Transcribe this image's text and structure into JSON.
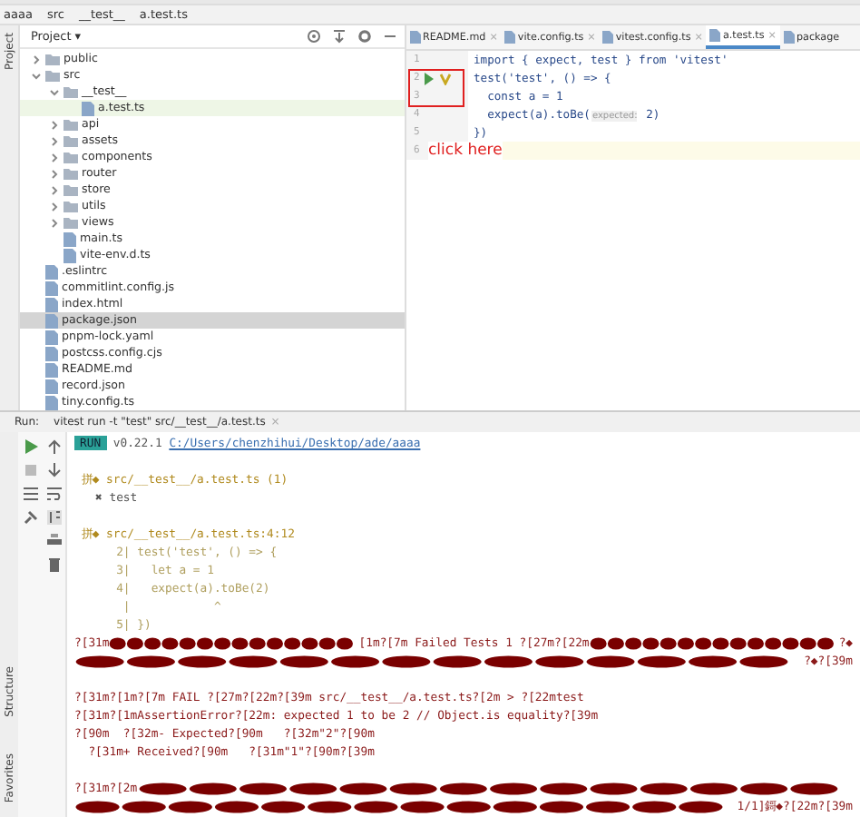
{
  "breadcrumb": [
    "aaaa",
    "src",
    "__test__",
    "a.test.ts"
  ],
  "side_strip": {
    "label": "Project"
  },
  "project": {
    "title": "Project ▾",
    "tree": [
      {
        "name": "public",
        "kind": "folder",
        "expanded": false,
        "selected": false,
        "highlighted": false
      },
      {
        "name": "src",
        "kind": "folder",
        "expanded": true,
        "selected": false,
        "highlighted": false,
        "children": [
          {
            "name": "__test__",
            "kind": "folder",
            "expanded": true,
            "selected": false,
            "highlighted": false,
            "children": [
              {
                "name": "a.test.ts",
                "kind": "file",
                "selected": false,
                "highlighted": true
              }
            ]
          },
          {
            "name": "api",
            "kind": "folder",
            "expanded": false,
            "selected": false,
            "highlighted": false
          },
          {
            "name": "assets",
            "kind": "folder",
            "expanded": false,
            "selected": false,
            "highlighted": false
          },
          {
            "name": "components",
            "kind": "folder",
            "expanded": false,
            "selected": false,
            "highlighted": false
          },
          {
            "name": "router",
            "kind": "folder",
            "expanded": false,
            "selected": false,
            "highlighted": false
          },
          {
            "name": "store",
            "kind": "folder",
            "expanded": false,
            "selected": false,
            "highlighted": false
          },
          {
            "name": "utils",
            "kind": "folder",
            "expanded": false,
            "selected": false,
            "highlighted": false
          },
          {
            "name": "views",
            "kind": "folder",
            "expanded": false,
            "selected": false,
            "highlighted": false
          },
          {
            "name": "main.ts",
            "kind": "file",
            "selected": false,
            "highlighted": false
          },
          {
            "name": "vite-env.d.ts",
            "kind": "file",
            "selected": false,
            "highlighted": false
          }
        ]
      },
      {
        "name": ".eslintrc",
        "kind": "file",
        "selected": false,
        "highlighted": false
      },
      {
        "name": "commitlint.config.js",
        "kind": "file",
        "selected": false,
        "highlighted": false
      },
      {
        "name": "index.html",
        "kind": "file",
        "selected": false,
        "highlighted": false
      },
      {
        "name": "package.json",
        "kind": "file",
        "selected": true,
        "highlighted": false
      },
      {
        "name": "pnpm-lock.yaml",
        "kind": "file",
        "selected": false,
        "highlighted": false
      },
      {
        "name": "postcss.config.cjs",
        "kind": "file",
        "selected": false,
        "highlighted": false
      },
      {
        "name": "README.md",
        "kind": "file",
        "selected": false,
        "highlighted": false
      },
      {
        "name": "record.json",
        "kind": "file",
        "selected": false,
        "highlighted": false
      },
      {
        "name": "tiny.config.ts",
        "kind": "file",
        "selected": false,
        "highlighted": false
      }
    ]
  },
  "editor": {
    "tabs": [
      {
        "label": "README.md",
        "close": "×",
        "selected": false
      },
      {
        "label": "vite.config.ts",
        "close": "×",
        "selected": false
      },
      {
        "label": "vitest.config.ts",
        "close": "×",
        "selected": false
      },
      {
        "label": "a.test.ts",
        "close": "×",
        "selected": true
      },
      {
        "label": "package",
        "selected": false
      }
    ],
    "lines": [
      {
        "number": "1",
        "code": "import { expect, test } from 'vitest'",
        "run_marker": false
      },
      {
        "number": "2",
        "code": "test('test', () => {",
        "run_marker": true
      },
      {
        "number": "3",
        "code": "  const a = 1",
        "run_marker": false
      },
      {
        "number": "4",
        "code": "  expect(a).toBe(",
        "hint": "expected:",
        "code_after": " 2)",
        "run_marker": false
      },
      {
        "number": "5",
        "code": "})",
        "run_marker": false
      },
      {
        "number": "6",
        "run_marker": false
      }
    ],
    "annotation": "click here"
  },
  "run": {
    "label": "Run:",
    "tab": "vitest run -t \"test\" src/__test__/a.test.ts",
    "tab_close": "×",
    "side_labels": [
      "Structure",
      "Favorites"
    ],
    "console": [
      {
        "kind": "run",
        "segments": [
          {
            "kind": "badge",
            "text": "RUN"
          },
          {
            "kind": "text",
            "text": " v0.22.1 "
          },
          {
            "kind": "link",
            "text": "C:/Users/chenzhihui/Desktop/ade/aaaa"
          }
        ]
      },
      {
        "kind": "blank"
      },
      {
        "kind": "file",
        "segments": [
          {
            "kind": "text",
            "text": " 拼◆ src/__test__/a.test.ts (1)"
          }
        ]
      },
      {
        "kind": "plain",
        "segments": [
          {
            "kind": "text",
            "text": "   ✖ test"
          }
        ]
      },
      {
        "kind": "blank"
      },
      {
        "kind": "file",
        "segments": [
          {
            "kind": "text",
            "text": " 拼◆ src/__test__/a.test.ts:4:12"
          }
        ]
      },
      {
        "kind": "code",
        "segments": [
          {
            "kind": "text",
            "text": "      2| test('test', () => {"
          }
        ]
      },
      {
        "kind": "code",
        "segments": [
          {
            "kind": "text",
            "text": "      3|   let a = 1"
          }
        ]
      },
      {
        "kind": "code",
        "segments": [
          {
            "kind": "text",
            "text": "      4|   expect(a).toBe(2)"
          }
        ]
      },
      {
        "kind": "code",
        "segments": [
          {
            "kind": "text",
            "text": "       |            ^"
          }
        ]
      },
      {
        "kind": "code",
        "segments": [
          {
            "kind": "text",
            "text": "      5| })"
          }
        ]
      },
      {
        "kind": "error",
        "segments": [
          {
            "kind": "text",
            "text": "?[31m"
          },
          {
            "kind": "garbled"
          },
          {
            "kind": "text",
            "text": "[1m?[7m Failed Tests 1 ?[27m?[22m"
          },
          {
            "kind": "garbled"
          },
          {
            "kind": "text",
            "text": "?◆"
          }
        ]
      },
      {
        "kind": "error",
        "segments": [
          {
            "kind": "garbled"
          },
          {
            "kind": "text",
            "text": "?◆?[39m"
          }
        ]
      },
      {
        "kind": "blank"
      },
      {
        "kind": "error",
        "segments": [
          {
            "kind": "text",
            "text": "?[31m?[1m?[7m FAIL ?[27m?[22m?[39m src/__test__/a.test.ts?[2m > ?[22mtest"
          }
        ]
      },
      {
        "kind": "error",
        "segments": [
          {
            "kind": "text",
            "text": "?[31m?[1mAssertionError?[22m: expected 1 to be 2 // Object.is equality?[39m"
          }
        ]
      },
      {
        "kind": "error",
        "segments": [
          {
            "kind": "text",
            "text": "?[90m  ?[32m- Expected?[90m   ?[32m\"2\"?[90m"
          }
        ]
      },
      {
        "kind": "error",
        "segments": [
          {
            "kind": "text",
            "text": "  ?[31m+ Received?[90m   ?[31m\"1\"?[90m?[39m"
          }
        ]
      },
      {
        "kind": "blank"
      },
      {
        "kind": "error",
        "segments": [
          {
            "kind": "text",
            "text": "?[31m?[2m"
          },
          {
            "kind": "garbled"
          }
        ]
      },
      {
        "kind": "error",
        "segments": [
          {
            "kind": "garbled"
          },
          {
            "kind": "text",
            "text": "1/1]鎶◆?[22m?[39m"
          }
        ]
      }
    ]
  }
}
